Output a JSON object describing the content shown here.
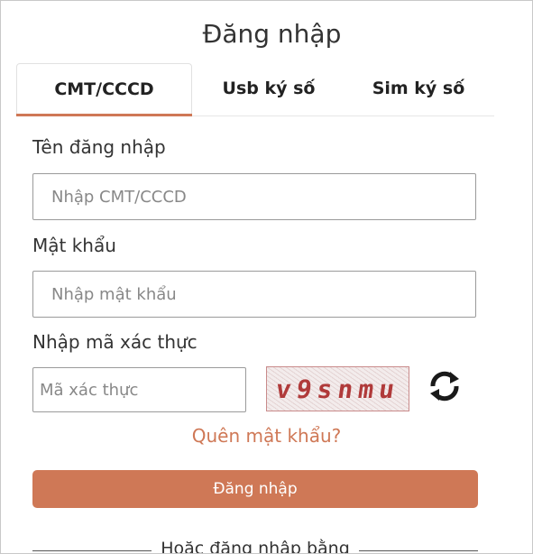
{
  "page_title": "Đăng nhập",
  "tabs": [
    {
      "label": "CMT/CCCD",
      "active": true
    },
    {
      "label": "Usb ký số",
      "active": false
    },
    {
      "label": "Sim ký số",
      "active": false
    }
  ],
  "form": {
    "username_label": "Tên đăng nhập",
    "username_placeholder": "Nhập CMT/CCCD",
    "password_label": "Mật khẩu",
    "password_placeholder": "Nhập mật khẩu",
    "captcha_label": "Nhập mã xác thực",
    "captcha_placeholder": "Mã xác thực",
    "captcha_text": "v9snmu",
    "forgot_password": "Quên mật khẩu?",
    "submit_label": "Đăng nhập",
    "alt_login_text": "Hoặc đăng nhập bằng"
  },
  "colors": {
    "accent": "#cf7856",
    "captcha_text": "#b03a3a"
  },
  "icons": {
    "refresh": "refresh-icon"
  }
}
